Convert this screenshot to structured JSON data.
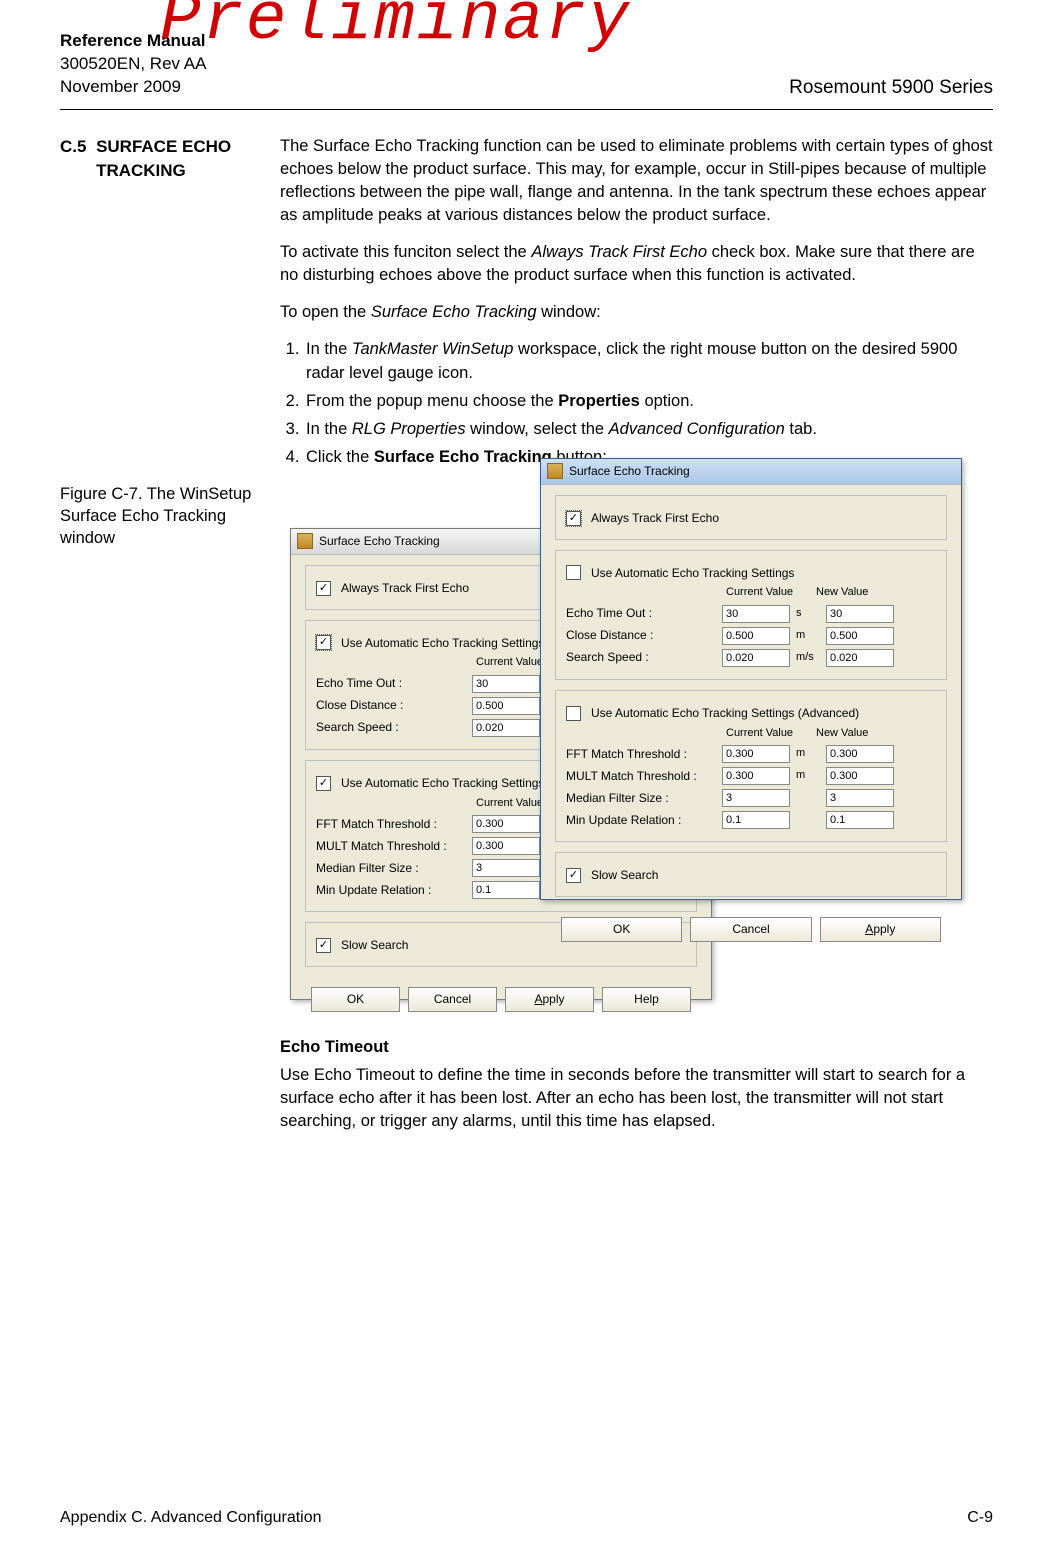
{
  "header": {
    "manual_title": "Reference Manual",
    "doc_no": "300520EN, Rev AA",
    "date": "November 2009",
    "series": "Rosemount 5900 Series",
    "watermark": "Preliminary"
  },
  "section": {
    "number": "C.5",
    "title": "SURFACE ECHO TRACKING",
    "p1": "The Surface Echo Tracking function can be used to eliminate problems with certain types of ghost echoes below the product surface. This may, for example, occur in Still-pipes because of multiple reflections between the pipe wall, flange and antenna. In the tank spectrum these echoes appear as amplitude peaks at various distances below the product surface.",
    "p2_prefix": "To activate this funciton select the ",
    "p2_italic": "Always Track First Echo",
    "p2_suffix": " check box. Make sure that there are no disturbing echoes above the product surface when this function is activated.",
    "p3_prefix": "To open the ",
    "p3_italic": "Surface Echo Tracking",
    "p3_suffix": " window:",
    "step1_prefix": "In the ",
    "step1_italic": "TankMaster WinSetup",
    "step1_suffix": " workspace, click the right mouse button on the desired 5900 radar level gauge icon.",
    "step2_prefix": "From the popup menu choose the ",
    "step2_bold": "Properties",
    "step2_suffix": " option.",
    "step3_prefix": "In the ",
    "step3_italic1": "RLG Properties",
    "step3_mid": " window, select the ",
    "step3_italic2": "Advanced Configuration",
    "step3_suffix": " tab.",
    "step4_prefix": "Click the ",
    "step4_bold": "Surface Echo Tracking",
    "step4_suffix": " button:"
  },
  "figure": {
    "label": "Figure C-7. The WinSetup Surface Echo Tracking window"
  },
  "dialog": {
    "title": "Surface Echo Tracking",
    "always_first": "Always Track First Echo",
    "use_auto": "Use Automatic Echo Tracking Settings",
    "col_current": "Current Value",
    "col_new": "New Value",
    "rows_basic": [
      {
        "label": "Echo Time Out :",
        "current": "30",
        "unit": "s",
        "new": "30"
      },
      {
        "label": "Close Distance :",
        "current": "0.500",
        "unit": "m",
        "new": "0.500"
      },
      {
        "label": "Search Speed :",
        "current": "0.020",
        "unit": "m/s",
        "new": "0.020"
      }
    ],
    "use_auto_adv": "Use Automatic Echo Tracking  Settings (Advanced)",
    "rows_adv": [
      {
        "label": "FFT Match Threshold :",
        "current": "0.300",
        "unit": "m",
        "new": "0.300"
      },
      {
        "label": "MULT Match Threshold :",
        "current": "0.300",
        "unit": "m",
        "new": "0.300"
      },
      {
        "label": "Median Filter Size :",
        "current": "3",
        "unit": "",
        "new": "3"
      },
      {
        "label": "Min Update Relation :",
        "current": "0.1",
        "unit": "",
        "new": "0.1"
      }
    ],
    "slow_search": "Slow Search",
    "btn_ok": "OK",
    "btn_cancel": "Cancel",
    "btn_apply": "Apply",
    "btn_help": "Help"
  },
  "echo_timeout": {
    "heading": "Echo Timeout",
    "body": "Use Echo Timeout to define the time in seconds before the transmitter will start to search for a surface echo after it has been lost. After an echo has been lost, the transmitter will not start searching, or trigger any alarms, until this time has elapsed."
  },
  "footer": {
    "left": "Appendix C. Advanced Configuration",
    "right": "C-9"
  }
}
